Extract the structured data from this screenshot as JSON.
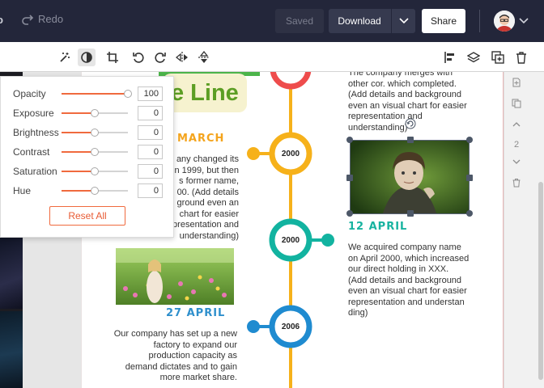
{
  "topbar": {
    "undo_label": "o",
    "redo_label": "Redo",
    "saved_label": "Saved",
    "download_label": "Download",
    "share_label": "Share"
  },
  "adjust": {
    "rows": [
      {
        "label": "Opacity",
        "value": "100",
        "level": 1.0
      },
      {
        "label": "Exposure",
        "value": "0",
        "level": 0.5
      },
      {
        "label": "Brightness",
        "value": "0",
        "level": 0.5
      },
      {
        "label": "Contrast",
        "value": "0",
        "level": 0.5
      },
      {
        "label": "Saturation",
        "value": "0",
        "level": 0.5
      },
      {
        "label": "Hue",
        "value": "0",
        "level": 0.5
      }
    ],
    "reset_label": "Reset All"
  },
  "page": {
    "title_text": "e Line",
    "left_top": {
      "date": "MARCH",
      "lines": [
        "any changed its",
        "n 1999, but then",
        "s former name,",
        "00. (Add details",
        "ground even an",
        "chart for easier",
        "representation and",
        "understanding)"
      ]
    },
    "left_bottom": {
      "date": "27 APRIL",
      "lines": [
        "Our company has set up a new",
        "factory to expand our",
        "production capacity as",
        "demand dictates and to gain",
        "more market share."
      ]
    },
    "right_top": {
      "lines": [
        "The company merges with",
        "other cor. which completed.",
        "(Add details and background",
        "even an visual chart for easier",
        "representation and",
        "understanding)"
      ]
    },
    "right_mid": {
      "date": "12 APRIL",
      "lines": [
        "We acquired company name",
        "on April 2000, which increased",
        "our direct holding in XXX.",
        "(Add details and background",
        "even an visual chart for easier",
        "representation and understan",
        "ding)"
      ]
    },
    "nodes": [
      "2000",
      "2000",
      "2006"
    ]
  },
  "right_panel": {
    "page_number": "2"
  },
  "colors": {
    "topbar": "#23263a",
    "accent_orange": "#f06a3e",
    "timeline_yellow": "#f6b11a",
    "timeline_teal": "#12b3a0",
    "timeline_blue": "#1f8bd0",
    "timeline_red": "#ee4c4c",
    "date_orange": "#f4a41d",
    "date_blue": "#2e8fcc",
    "date_teal": "#17b3a0"
  }
}
